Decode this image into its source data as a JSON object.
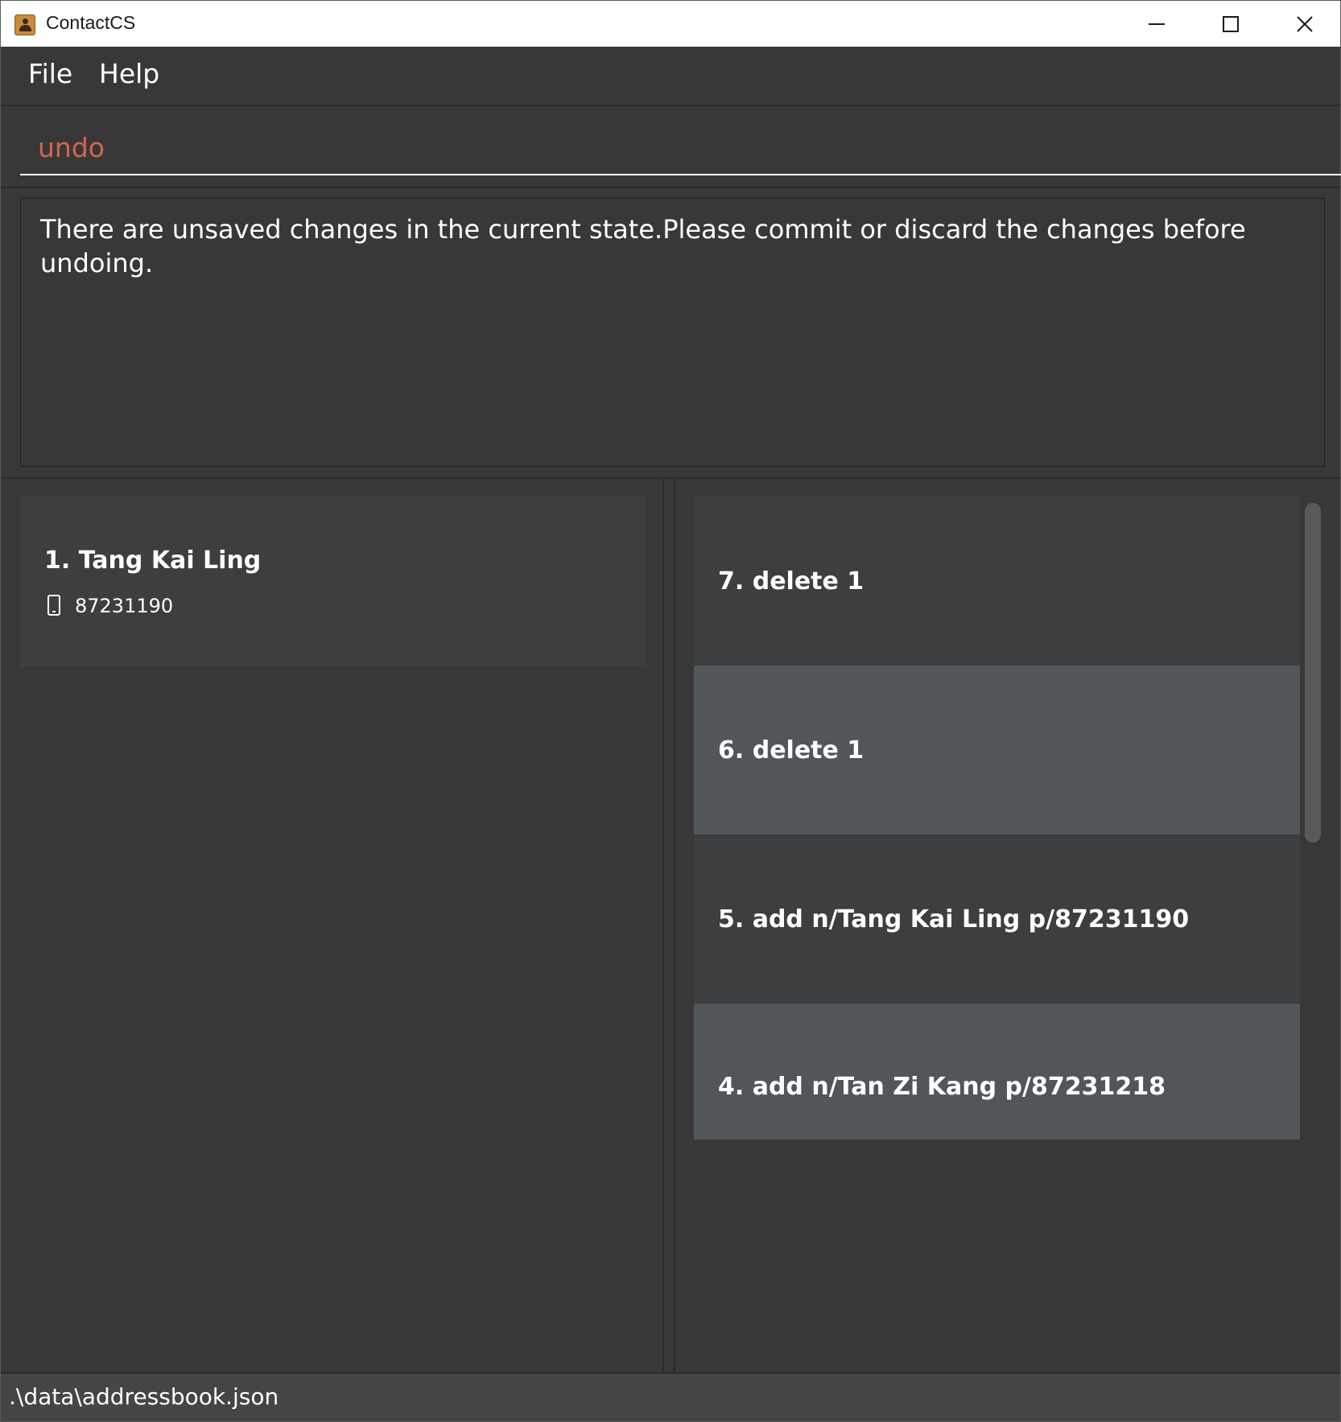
{
  "window": {
    "title": "ContactCS"
  },
  "menu": {
    "file": "File",
    "help": "Help"
  },
  "command": {
    "value": "undo"
  },
  "result": {
    "message": "There are unsaved changes in the current state.Please commit or discard the changes before undoing."
  },
  "persons": [
    {
      "name": "1. Tang Kai Ling",
      "phone": "87231190"
    }
  ],
  "history": [
    {
      "label": "7. delete 1"
    },
    {
      "label": "6. delete 1"
    },
    {
      "label": "5. add n/Tang Kai Ling p/87231190"
    },
    {
      "label": "4. add n/Tan Zi Kang p/87231218"
    }
  ],
  "status": {
    "path": ".\\data\\addressbook.json"
  },
  "colors": {
    "background": "#383838",
    "command_text": "#d06651",
    "card_dark": "#3c3e3f",
    "card_light": "#515658",
    "text": "#ffffff"
  }
}
